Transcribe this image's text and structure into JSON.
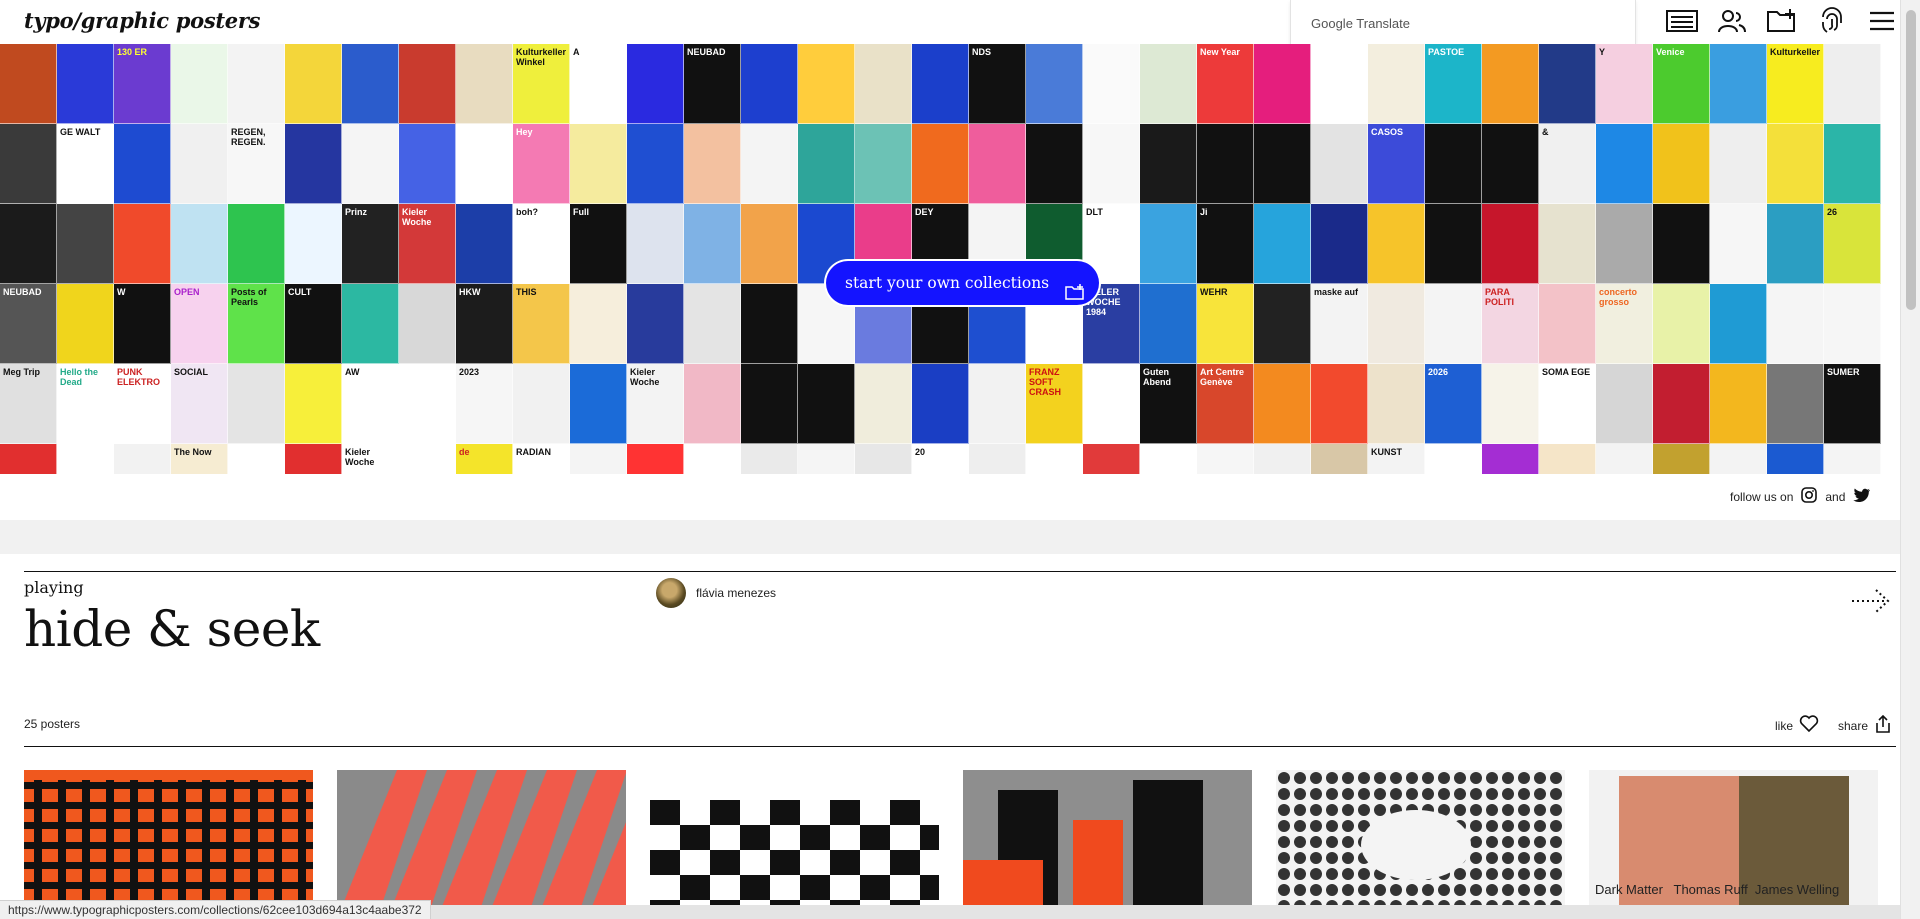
{
  "header": {
    "logo": "typo/graphic posters",
    "translate_label": "Google Translate",
    "icons": [
      "list-icon",
      "users-icon",
      "add-folder-icon",
      "fingerprint-icon",
      "menu-icon"
    ]
  },
  "mosaic": {
    "cta_label": "start your own collections",
    "tiles": [
      {
        "bg": "#c04a1f",
        "fg": "#fff",
        "t": ""
      },
      {
        "bg": "#2a3ad8",
        "fg": "#fff",
        "t": ""
      },
      {
        "bg": "#6b3bd0",
        "fg": "#ff3",
        "t": "130 ER"
      },
      {
        "bg": "#eaf7e8",
        "fg": "#3a9",
        "t": ""
      },
      {
        "bg": "#f3f3f3",
        "fg": "#d33",
        "t": ""
      },
      {
        "bg": "#f4d63a",
        "fg": "#22a",
        "t": ""
      },
      {
        "bg": "#2b5ccc",
        "fg": "#fff",
        "t": ""
      },
      {
        "bg": "#c93b2e",
        "fg": "#fff",
        "t": ""
      },
      {
        "bg": "#e8dcc0",
        "fg": "#333",
        "t": ""
      },
      {
        "bg": "#efef3c",
        "fg": "#111",
        "t": "Kulturkeller Winkel"
      },
      {
        "bg": "#ffffff",
        "fg": "#111",
        "t": "A"
      },
      {
        "bg": "#2a2ae0",
        "fg": "#fff",
        "t": ""
      },
      {
        "bg": "#111",
        "fg": "#fff",
        "t": "NEUBAD"
      },
      {
        "bg": "#1d3fcf",
        "fg": "#fff",
        "t": ""
      },
      {
        "bg": "#ffcd3c",
        "fg": "#111",
        "t": ""
      },
      {
        "bg": "#e9e1c8",
        "fg": "#111",
        "t": ""
      },
      {
        "bg": "#1b3fcb",
        "fg": "#fff",
        "t": ""
      },
      {
        "bg": "#111",
        "fg": "#fff",
        "t": "NDS"
      },
      {
        "bg": "#4a7bd8",
        "fg": "#fff",
        "t": ""
      },
      {
        "bg": "#fafafa",
        "fg": "#111",
        "t": ""
      },
      {
        "bg": "#dde9d4",
        "fg": "#111",
        "t": ""
      },
      {
        "bg": "#ed3a3a",
        "fg": "#fff",
        "t": "New Year"
      },
      {
        "bg": "#e51e7d",
        "fg": "#fff",
        "t": ""
      },
      {
        "bg": "#fff",
        "fg": "#111",
        "t": ""
      },
      {
        "bg": "#f3eede",
        "fg": "#111",
        "t": ""
      },
      {
        "bg": "#1cb5c9",
        "fg": "#fff",
        "t": "PASTOE"
      },
      {
        "bg": "#f39a22",
        "fg": "#111",
        "t": ""
      },
      {
        "bg": "#223a88",
        "fg": "#fff",
        "t": ""
      },
      {
        "bg": "#f5cfe0",
        "fg": "#111",
        "t": "Y"
      },
      {
        "bg": "#4ccb2e",
        "fg": "#fff",
        "t": "Venice"
      },
      {
        "bg": "#3a9ee0",
        "fg": "#fff",
        "t": ""
      },
      {
        "bg": "#f7ec1f",
        "fg": "#111",
        "t": "Kulturkeller"
      },
      {
        "bg": "#eee",
        "fg": "#c11",
        "t": ""
      },
      {
        "bg": "#3a3a3a",
        "fg": "#fff",
        "t": ""
      },
      {
        "bg": "#fff",
        "fg": "#111",
        "t": "GE WALT"
      },
      {
        "bg": "#1e4bd1",
        "fg": "#fff",
        "t": ""
      },
      {
        "bg": "#f0f0f0",
        "fg": "#111",
        "t": ""
      },
      {
        "bg": "#f7f7f7",
        "fg": "#111",
        "t": "REGEN, REGEN."
      },
      {
        "bg": "#2536a0",
        "fg": "#fff",
        "t": ""
      },
      {
        "bg": "#f5f5f5",
        "fg": "#111",
        "t": ""
      },
      {
        "bg": "#4562e5",
        "fg": "#fff",
        "t": ""
      },
      {
        "bg": "#fff",
        "fg": "#c1d",
        "t": ""
      },
      {
        "bg": "#f47ab3",
        "fg": "#fff",
        "t": "Hey"
      },
      {
        "bg": "#f5eb9e",
        "fg": "#c22",
        "t": ""
      },
      {
        "bg": "#1f4fd2",
        "fg": "#fff",
        "t": ""
      },
      {
        "bg": "#f3c1a0",
        "fg": "#111",
        "t": ""
      },
      {
        "bg": "#f4f4f4",
        "fg": "#111",
        "t": ""
      },
      {
        "bg": "#2ea59a",
        "fg": "#fff",
        "t": ""
      },
      {
        "bg": "#6cc2b5",
        "fg": "#fff",
        "t": ""
      },
      {
        "bg": "#f06a1e",
        "fg": "#fff",
        "t": ""
      },
      {
        "bg": "#ef5d9c",
        "fg": "#fff",
        "t": ""
      },
      {
        "bg": "#111",
        "fg": "#fff",
        "t": ""
      },
      {
        "bg": "#f7f7f7",
        "fg": "#111",
        "t": ""
      },
      {
        "bg": "#1a1a1a",
        "fg": "#fff",
        "t": ""
      },
      {
        "bg": "#111",
        "fg": "#fff",
        "t": ""
      },
      {
        "bg": "#111",
        "fg": "#fff",
        "t": ""
      },
      {
        "bg": "#e3e3e3",
        "fg": "#111",
        "t": ""
      },
      {
        "bg": "#3c4bd9",
        "fg": "#fff",
        "t": "CASOS"
      },
      {
        "bg": "#111",
        "fg": "#fff",
        "t": ""
      },
      {
        "bg": "#111",
        "fg": "#fff",
        "t": ""
      },
      {
        "bg": "#f0f0f0",
        "fg": "#111",
        "t": "&"
      },
      {
        "bg": "#1e88e5",
        "fg": "#fff",
        "t": ""
      },
      {
        "bg": "#f1c21b",
        "fg": "#111",
        "t": ""
      },
      {
        "bg": "#eee",
        "fg": "#111",
        "t": ""
      },
      {
        "bg": "#f4e03a",
        "fg": "#111",
        "t": ""
      },
      {
        "bg": "#2bb5a8",
        "fg": "#fff",
        "t": ""
      },
      {
        "bg": "#1b1b1b",
        "fg": "#fff",
        "t": ""
      },
      {
        "bg": "#444",
        "fg": "#fff",
        "t": ""
      },
      {
        "bg": "#f04a2b",
        "fg": "#fff",
        "t": ""
      },
      {
        "bg": "#bfe2f2",
        "fg": "#111",
        "t": ""
      },
      {
        "bg": "#2ec44f",
        "fg": "#fff",
        "t": ""
      },
      {
        "bg": "#ecf6ff",
        "fg": "#111",
        "t": ""
      },
      {
        "bg": "#222",
        "fg": "#fff",
        "t": "Prinz"
      },
      {
        "bg": "#d33939",
        "fg": "#fff",
        "t": "Kieler Woche"
      },
      {
        "bg": "#1c3ea8",
        "fg": "#fff",
        "t": ""
      },
      {
        "bg": "#fff",
        "fg": "#111",
        "t": "boh?"
      },
      {
        "bg": "#111",
        "fg": "#fff",
        "t": "Full"
      },
      {
        "bg": "#dde3ee",
        "fg": "#111",
        "t": ""
      },
      {
        "bg": "#7fb2e5",
        "fg": "#fff",
        "t": ""
      },
      {
        "bg": "#f2a34a",
        "fg": "#111",
        "t": ""
      },
      {
        "bg": "#1b49d0",
        "fg": "#fff",
        "t": ""
      },
      {
        "bg": "#ea3d8a",
        "fg": "#fff",
        "t": ""
      },
      {
        "bg": "#111",
        "fg": "#fff",
        "t": "DEY"
      },
      {
        "bg": "#f4f4f4",
        "fg": "#111",
        "t": ""
      },
      {
        "bg": "#0f5c2f",
        "fg": "#fff",
        "t": ""
      },
      {
        "bg": "#fff",
        "fg": "#111",
        "t": "DLT"
      },
      {
        "bg": "#3aa3e0",
        "fg": "#fff",
        "t": ""
      },
      {
        "bg": "#111",
        "fg": "#fff",
        "t": "Ji"
      },
      {
        "bg": "#26a4dc",
        "fg": "#fff",
        "t": ""
      },
      {
        "bg": "#1a2a8a",
        "fg": "#fff",
        "t": ""
      },
      {
        "bg": "#f6c42a",
        "fg": "#c11",
        "t": ""
      },
      {
        "bg": "#111",
        "fg": "#fff",
        "t": ""
      },
      {
        "bg": "#c6162b",
        "fg": "#fff",
        "t": ""
      },
      {
        "bg": "#e6e2cf",
        "fg": "#111",
        "t": ""
      },
      {
        "bg": "#aaa",
        "fg": "#111",
        "t": ""
      },
      {
        "bg": "#111",
        "fg": "#fff",
        "t": ""
      },
      {
        "bg": "#f6f6f6",
        "fg": "#c22",
        "t": ""
      },
      {
        "bg": "#2b9ec2",
        "fg": "#fff",
        "t": ""
      },
      {
        "bg": "#d9e43a",
        "fg": "#111",
        "t": "26"
      },
      {
        "bg": "#555",
        "fg": "#fff",
        "t": "NEUBAD"
      },
      {
        "bg": "#f0d51c",
        "fg": "#e22",
        "t": ""
      },
      {
        "bg": "#111",
        "fg": "#fff",
        "t": "W"
      },
      {
        "bg": "#f7d2ee",
        "fg": "#a2c",
        "t": "OPEN"
      },
      {
        "bg": "#5fe24a",
        "fg": "#111",
        "t": "Posts of Pearls"
      },
      {
        "bg": "#111",
        "fg": "#fff",
        "t": "CULT"
      },
      {
        "bg": "#2cb8a2",
        "fg": "#fff",
        "t": ""
      },
      {
        "bg": "#d8d8d8",
        "fg": "#111",
        "t": ""
      },
      {
        "bg": "#1c1c1c",
        "fg": "#fff",
        "t": "HKW"
      },
      {
        "bg": "#f4c64a",
        "fg": "#111",
        "t": "THIS"
      },
      {
        "bg": "#f6eedc",
        "fg": "#c22",
        "t": ""
      },
      {
        "bg": "#283b9c",
        "fg": "#fff",
        "t": ""
      },
      {
        "bg": "#e4e4e4",
        "fg": "#111",
        "t": ""
      },
      {
        "bg": "#111",
        "fg": "#fff",
        "t": ""
      },
      {
        "bg": "#f6f6f6",
        "fg": "#111",
        "t": ""
      },
      {
        "bg": "#6a7bdf",
        "fg": "#fff",
        "t": ""
      },
      {
        "bg": "#111",
        "fg": "#fff",
        "t": "OPEN CALL!"
      },
      {
        "bg": "#1e4fd0",
        "fg": "#fff",
        "t": ""
      },
      {
        "bg": "#fff",
        "fg": "#111",
        "t": ""
      },
      {
        "bg": "#2a3ea2",
        "fg": "#fff",
        "t": "KIELER WOCHE 1984"
      },
      {
        "bg": "#1f6fd0",
        "fg": "#fff",
        "t": ""
      },
      {
        "bg": "#f8e43a",
        "fg": "#111",
        "t": "WEHR"
      },
      {
        "bg": "#222",
        "fg": "#fff",
        "t": ""
      },
      {
        "bg": "#f3f3f3",
        "fg": "#111",
        "t": "maske auf"
      },
      {
        "bg": "#f0eae0",
        "fg": "#c33",
        "t": ""
      },
      {
        "bg": "#f4f4f4",
        "fg": "#111",
        "t": ""
      },
      {
        "bg": "#f3d6e2",
        "fg": "#c22",
        "t": "PARA POLITI"
      },
      {
        "bg": "#f3c2c8",
        "fg": "#d22",
        "t": ""
      },
      {
        "bg": "#f1efdf",
        "fg": "#e62",
        "t": "concerto grosso"
      },
      {
        "bg": "#e8f2a8",
        "fg": "#111",
        "t": ""
      },
      {
        "bg": "#1f9bd4",
        "fg": "#fff",
        "t": ""
      },
      {
        "bg": "#f5f5f5",
        "fg": "#111",
        "t": ""
      },
      {
        "bg": "#f6f6f6",
        "fg": "#111",
        "t": ""
      },
      {
        "bg": "#e0e0e0",
        "fg": "#111",
        "t": "Meg Trip"
      },
      {
        "bg": "#fff",
        "fg": "#2a8",
        "t": "Hello the Dead"
      },
      {
        "bg": "#fff",
        "fg": "#c22",
        "t": "PUNK ELEKTRO"
      },
      {
        "bg": "#f0e6f3",
        "fg": "#111",
        "t": "SOCIAL"
      },
      {
        "bg": "#e4e4e4",
        "fg": "#111",
        "t": ""
      },
      {
        "bg": "#f7ef3a",
        "fg": "#111",
        "t": ""
      },
      {
        "bg": "#fff",
        "fg": "#111",
        "t": "AW"
      },
      {
        "bg": "#fff",
        "fg": "#111",
        "t": ""
      },
      {
        "bg": "#f6f6f6",
        "fg": "#111",
        "t": "2023"
      },
      {
        "bg": "#f1f1f1",
        "fg": "#1bd",
        "t": ""
      },
      {
        "bg": "#1b6bd8",
        "fg": "#fff",
        "t": ""
      },
      {
        "bg": "#f3f3f3",
        "fg": "#111",
        "t": "Kieler Woche"
      },
      {
        "bg": "#f1b8c6",
        "fg": "#c22",
        "t": ""
      },
      {
        "bg": "#111",
        "fg": "#fff",
        "t": ""
      },
      {
        "bg": "#111",
        "fg": "#fff",
        "t": ""
      },
      {
        "bg": "#f0eddc",
        "fg": "#111",
        "t": ""
      },
      {
        "bg": "#1a3ec4",
        "fg": "#fff",
        "t": ""
      },
      {
        "bg": "#f2f2f2",
        "fg": "#111",
        "t": ""
      },
      {
        "bg": "#f3d21e",
        "fg": "#c11",
        "t": "FRANZ SOFT CRASH"
      },
      {
        "bg": "#fff",
        "fg": "#111",
        "t": ""
      },
      {
        "bg": "#111",
        "fg": "#fff",
        "t": "Guten Abend"
      },
      {
        "bg": "#d8472b",
        "fg": "#fff",
        "t": "Art Centre Genève"
      },
      {
        "bg": "#f38a1f",
        "fg": "#fff",
        "t": ""
      },
      {
        "bg": "#f24a2d",
        "fg": "#fff",
        "t": ""
      },
      {
        "bg": "#ede2cb",
        "fg": "#111",
        "t": ""
      },
      {
        "bg": "#1e5fd3",
        "fg": "#fff",
        "t": "2026"
      },
      {
        "bg": "#f6f3e9",
        "fg": "#c22",
        "t": ""
      },
      {
        "bg": "#fff",
        "fg": "#111",
        "t": "SOMA EGE"
      },
      {
        "bg": "#d6d6d6",
        "fg": "#111",
        "t": ""
      },
      {
        "bg": "#c21e30",
        "fg": "#fff",
        "t": ""
      },
      {
        "bg": "#f3b71e",
        "fg": "#111",
        "t": ""
      },
      {
        "bg": "#777",
        "fg": "#fff",
        "t": ""
      },
      {
        "bg": "#111",
        "fg": "#fff",
        "t": "SUMER"
      },
      {
        "bg": "#e12f2f",
        "fg": "#fff",
        "t": ""
      },
      {
        "bg": "#fff",
        "fg": "#111",
        "t": ""
      },
      {
        "bg": "#f2f2f2",
        "fg": "#c22",
        "t": ""
      },
      {
        "bg": "#f6ecd2",
        "fg": "#111",
        "t": "The Now"
      },
      {
        "bg": "#fff",
        "fg": "#111",
        "t": ""
      },
      {
        "bg": "#e12f2f",
        "fg": "#fff",
        "t": ""
      },
      {
        "bg": "#fff",
        "fg": "#111",
        "t": "Kieler Woche"
      },
      {
        "bg": "#fff",
        "fg": "#c22",
        "t": ""
      },
      {
        "bg": "#f4e42a",
        "fg": "#c22",
        "t": "de"
      },
      {
        "bg": "#fff",
        "fg": "#111",
        "t": "RADIAN"
      },
      {
        "bg": "#f4f4f4",
        "fg": "#111",
        "t": ""
      },
      {
        "bg": "#f33",
        "fg": "#fff",
        "t": ""
      },
      {
        "bg": "#fff",
        "fg": "#111",
        "t": ""
      },
      {
        "bg": "#eaeaea",
        "fg": "#111",
        "t": ""
      },
      {
        "bg": "#f5f5f5",
        "fg": "#111",
        "t": ""
      },
      {
        "bg": "#e7e7e7",
        "fg": "#111",
        "t": ""
      },
      {
        "bg": "#fff",
        "fg": "#111",
        "t": "20"
      },
      {
        "bg": "#eee",
        "fg": "#111",
        "t": ""
      },
      {
        "bg": "#fff",
        "fg": "#111",
        "t": ""
      },
      {
        "bg": "#e13a3a",
        "fg": "#fff",
        "t": ""
      },
      {
        "bg": "#fff",
        "fg": "#111",
        "t": ""
      },
      {
        "bg": "#f6f6f6",
        "fg": "#111",
        "t": ""
      },
      {
        "bg": "#f0f0f0",
        "fg": "#111",
        "t": ""
      },
      {
        "bg": "#d8c7a7",
        "fg": "#111",
        "t": ""
      },
      {
        "bg": "#f3f3f3",
        "fg": "#111",
        "t": "KUNST"
      },
      {
        "bg": "#fff",
        "fg": "#111",
        "t": ""
      },
      {
        "bg": "#a42dd3",
        "fg": "#fff",
        "t": ""
      },
      {
        "bg": "#f5e5c8",
        "fg": "#111",
        "t": ""
      },
      {
        "bg": "#f3f3f3",
        "fg": "#111",
        "t": ""
      },
      {
        "bg": "#c2a12f",
        "fg": "#fff",
        "t": ""
      },
      {
        "bg": "#f3f3f3",
        "fg": "#111",
        "t": ""
      },
      {
        "bg": "#1b5ad1",
        "fg": "#fff",
        "t": ""
      },
      {
        "bg": "#f4f4f4",
        "fg": "#111",
        "t": ""
      }
    ]
  },
  "social": {
    "follow_label": "follow us on",
    "and_label": "and"
  },
  "collection": {
    "playing_label": "playing",
    "title": "hide & seek",
    "author": "flávia menezes",
    "count_label": "25 posters",
    "like_label": "like",
    "share_label": "share",
    "cards": [
      {
        "name": "poster-card-1",
        "caption": "",
        "bg": "#f0581e",
        "fg": "#111"
      },
      {
        "name": "poster-card-2",
        "caption": "",
        "bg": "#8a8a8a",
        "fg": "#f15a4a"
      },
      {
        "name": "poster-card-3",
        "caption": "",
        "bg": "#ffffff",
        "fg": "#111"
      },
      {
        "name": "poster-card-4",
        "caption": "",
        "bg": "#8e8e8e",
        "fg": "#f04a1e"
      },
      {
        "name": "poster-card-5",
        "caption": "",
        "bg": "#f4f4f4",
        "fg": "#222"
      },
      {
        "name": "poster-card-6",
        "caption": "Dark Matter   Thomas Ruff  James Welling",
        "bg": "#f2f2f2",
        "fg": "#222"
      }
    ]
  },
  "status_url": "https://www.typographicposters.com/collections/62cee103d694a13c4aabe372"
}
